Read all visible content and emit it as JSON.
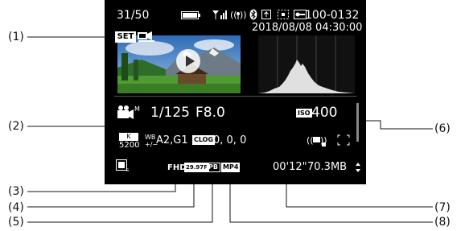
{
  "callouts": [
    {
      "label": "(1)"
    },
    {
      "label": "(2)"
    },
    {
      "label": "(3)"
    },
    {
      "label": "(4)"
    },
    {
      "label": "(5)"
    },
    {
      "label": "(6)"
    },
    {
      "label": "(7)"
    },
    {
      "label": "(8)"
    }
  ],
  "screen": {
    "top": {
      "frame_counter": "31/50",
      "folder_file": "100-0132",
      "datetime": "2018/08/08 04:30:00"
    },
    "set_label": "SET",
    "shooting": {
      "shutter": "1/125",
      "aperture": "F8.0",
      "iso_label": "ISO",
      "iso_value": "400"
    },
    "wb": {
      "k_label": "K",
      "kelvin": "5200",
      "wb_label": "WB",
      "wb_shift": "A2,G1"
    },
    "clog": {
      "label": "CLOG",
      "values": "0, 0, 0"
    },
    "recording": {
      "size": "FHD",
      "frame_rate": "29.97P",
      "compression": "IPB",
      "format": "MP4",
      "length": "00'12\"",
      "file_size": "70.3MB"
    },
    "icons": {
      "battery": "battery-icon",
      "signal": "signal-icon",
      "wifi": "wifi-icon",
      "bluetooth": "bluetooth-icon",
      "transfer": "transfer-icon",
      "rating": "rating-icon",
      "protect": "protect-icon",
      "movie_mode": "movie-mode-icon",
      "image_stabilizer": "stabilizer-icon",
      "frame": "frame-icon",
      "picture_style": "picture-style-icon",
      "scroll": "scroll-arrows-icon"
    }
  }
}
